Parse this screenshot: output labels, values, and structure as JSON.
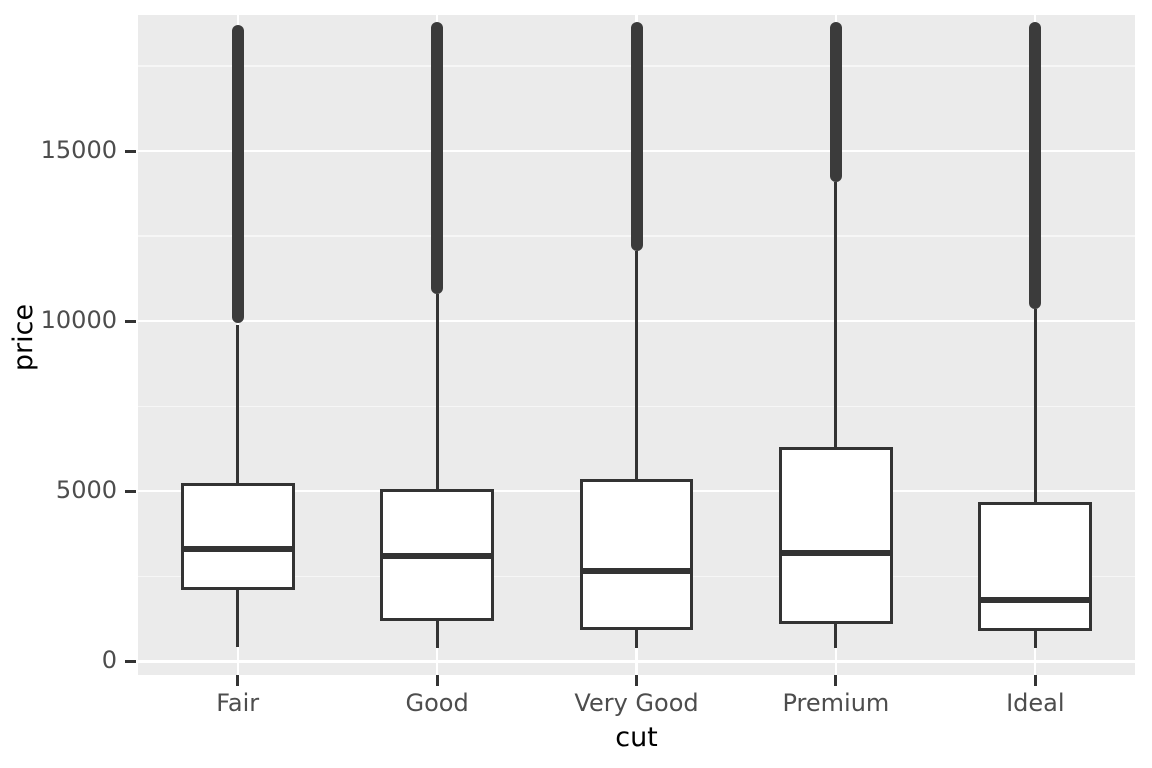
{
  "chart_data": {
    "type": "box",
    "title": "",
    "xlabel": "cut",
    "ylabel": "price",
    "categories": [
      "Fair",
      "Good",
      "Very Good",
      "Premium",
      "Ideal"
    ],
    "ylim": [
      -400,
      19000
    ],
    "ytick_labels": [
      "0",
      "5000",
      "10000",
      "15000"
    ],
    "ytick_values": [
      0,
      5000,
      10000,
      15000
    ],
    "yminor_values": [
      2500,
      7500,
      12500,
      17500
    ],
    "grid": true,
    "legend": "none",
    "theme": "ggplot2-grey",
    "panel_background": "#ebebeb",
    "gridline_color": "#ffffff",
    "box_fill": "#ffffff",
    "box_stroke": "#333333",
    "outlier_color": "#3b3b3b",
    "boxes": [
      {
        "category": "Fair",
        "lower_whisker": 432,
        "q1": 2100,
        "median": 3300,
        "q3": 5250,
        "upper_whisker": 9900,
        "outlier_min": 9950,
        "outlier_max": 18700
      },
      {
        "category": "Good",
        "lower_whisker": 405,
        "q1": 1175,
        "median": 3085,
        "q3": 5060,
        "upper_whisker": 10800,
        "outlier_min": 10800,
        "outlier_max": 18800
      },
      {
        "category": "Very Good",
        "lower_whisker": 405,
        "q1": 910,
        "median": 2650,
        "q3": 5375,
        "upper_whisker": 12050,
        "outlier_min": 12050,
        "outlier_max": 18800
      },
      {
        "category": "Premium",
        "lower_whisker": 405,
        "q1": 1110,
        "median": 3185,
        "q3": 6300,
        "upper_whisker": 14100,
        "outlier_min": 14100,
        "outlier_max": 18800
      },
      {
        "category": "Ideal",
        "lower_whisker": 405,
        "q1": 880,
        "median": 1810,
        "q3": 4680,
        "upper_whisker": 10350,
        "outlier_min": 10350,
        "outlier_max": 18800
      }
    ]
  }
}
